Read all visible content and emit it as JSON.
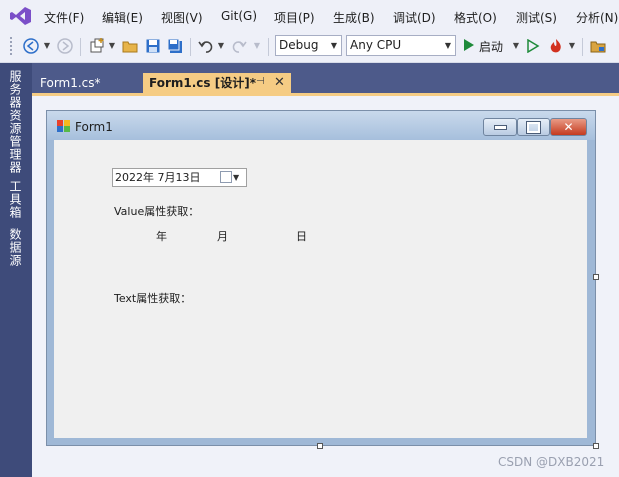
{
  "menu": [
    "文件(F)",
    "编辑(E)",
    "视图(V)",
    "Git(G)",
    "项目(P)",
    "生成(B)",
    "调试(D)",
    "格式(O)",
    "测试(S)",
    "分析(N)"
  ],
  "toolbar": {
    "config": "Debug",
    "platform": "Any CPU",
    "start_label": "启动"
  },
  "side_panel": [
    "服务器资源管理器",
    "工具箱",
    "数据源"
  ],
  "tabs": {
    "code_tab": "Form1.cs*",
    "design_tab": "Form1.cs [设计]*"
  },
  "form": {
    "title": "Form1",
    "date_value": "2022年  7月13日",
    "value_label": "Value属性获取：",
    "year_label": "年",
    "month_label": "月",
    "day_label": "日",
    "text_label": "Text属性获取："
  },
  "watermark": "CSDN @DXB2021",
  "colors": {
    "accent_tab": "#f5cc84",
    "side_panel": "#3e4b7a",
    "tab_strip": "#4d5a8a",
    "start_green": "#1e8a3a",
    "hot_reload_red": "#d2311f"
  }
}
